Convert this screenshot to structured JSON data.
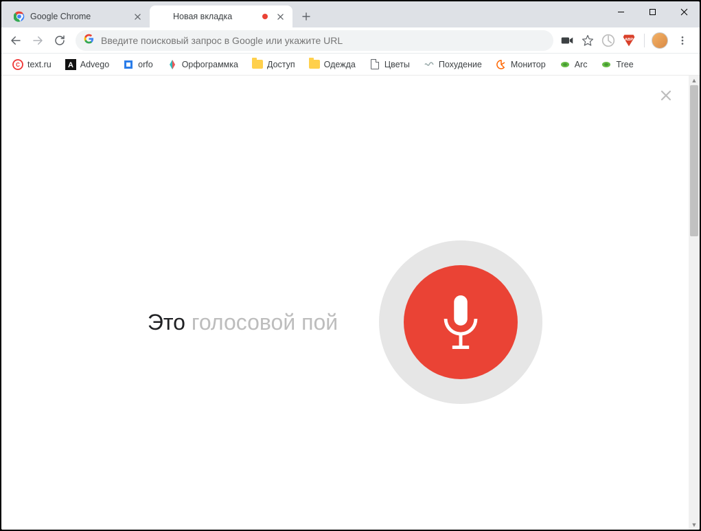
{
  "tabs": [
    {
      "title": "Google Chrome",
      "active": false
    },
    {
      "title": "Новая вкладка",
      "active": true,
      "recording": true
    }
  ],
  "omnibox": {
    "placeholder": "Введите поисковый запрос в Google или укажите URL"
  },
  "bookmarks": [
    {
      "label": "text.ru",
      "icon": "textru"
    },
    {
      "label": "Advego",
      "icon": "advego"
    },
    {
      "label": "orfo",
      "icon": "orfo"
    },
    {
      "label": "Орфограммка",
      "icon": "orfogr"
    },
    {
      "label": "Доступ",
      "icon": "folder"
    },
    {
      "label": "Одежда",
      "icon": "folder"
    },
    {
      "label": "Цветы",
      "icon": "doc"
    },
    {
      "label": "Похудение",
      "icon": "pohud"
    },
    {
      "label": "Монитор",
      "icon": "monitor"
    },
    {
      "label": "Arc",
      "icon": "arc"
    },
    {
      "label": "Tree",
      "icon": "tree"
    }
  ],
  "voice": {
    "text_dark": "Это",
    "text_light": " голосовой пой"
  }
}
